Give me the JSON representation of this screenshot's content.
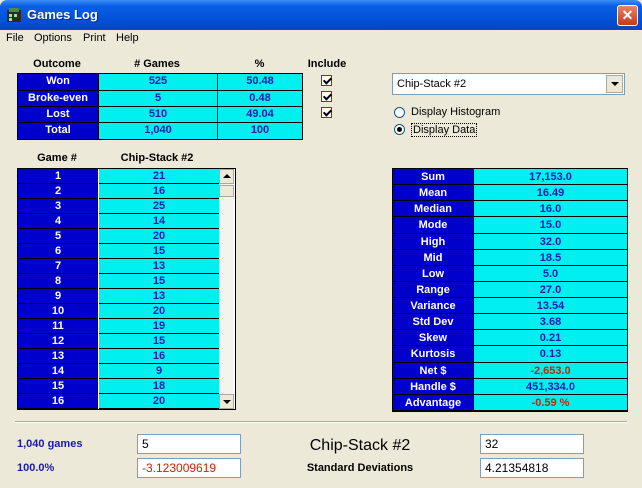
{
  "window": {
    "title": "Games Log"
  },
  "menu": [
    "File",
    "Options",
    "Print",
    "Help"
  ],
  "summary": {
    "headers": [
      "Outcome",
      "# Games",
      "%",
      "Include"
    ],
    "rows": [
      {
        "label": "Won",
        "games": "525",
        "pct": "50.48",
        "checked": true
      },
      {
        "label": "Broke-even",
        "games": "5",
        "pct": "0.48",
        "checked": true
      },
      {
        "label": "Lost",
        "games": "510",
        "pct": "49.04",
        "checked": true
      },
      {
        "label": "Total",
        "games": "1,040",
        "pct": "100"
      }
    ]
  },
  "selector": {
    "selected": "Chip-Stack #2",
    "options": [
      {
        "label": "Display Histogram",
        "selected": false
      },
      {
        "label": "Display Data",
        "selected": true
      }
    ]
  },
  "game_list": {
    "headers": [
      "Game #",
      "Chip-Stack #2"
    ],
    "rows": [
      [
        "1",
        "21"
      ],
      [
        "2",
        "16"
      ],
      [
        "3",
        "25"
      ],
      [
        "4",
        "14"
      ],
      [
        "5",
        "20"
      ],
      [
        "6",
        "15"
      ],
      [
        "7",
        "13"
      ],
      [
        "8",
        "15"
      ],
      [
        "9",
        "13"
      ],
      [
        "10",
        "20"
      ],
      [
        "11",
        "19"
      ],
      [
        "12",
        "15"
      ],
      [
        "13",
        "16"
      ],
      [
        "14",
        "9"
      ],
      [
        "15",
        "18"
      ],
      [
        "16",
        "20"
      ]
    ]
  },
  "stats": [
    {
      "label": "Sum",
      "value": "17,153.0"
    },
    {
      "label": "Mean",
      "value": "16.49"
    },
    {
      "label": "Median",
      "value": "16.0"
    },
    {
      "label": "Mode",
      "value": "15.0"
    },
    {
      "label": "High",
      "value": "32.0"
    },
    {
      "label": "Mid",
      "value": "18.5"
    },
    {
      "label": "Low",
      "value": "5.0"
    },
    {
      "label": "Range",
      "value": "27.0"
    },
    {
      "label": "Variance",
      "value": "13.54"
    },
    {
      "label": "Std Dev",
      "value": "3.68"
    },
    {
      "label": "Skew",
      "value": "0.21"
    },
    {
      "label": "Kurtosis",
      "value": "0.13"
    },
    {
      "label": "Net $",
      "value": "-2,653.0",
      "negative": true
    },
    {
      "label": "Handle $",
      "value": "451,334.0"
    },
    {
      "label": "Advantage",
      "value": "-0.59 %",
      "negative": true
    }
  ],
  "footer": {
    "games_count": "1,040 games",
    "percent": "100.0%",
    "field_left_top": "5",
    "field_left_bottom": "-3.123009619",
    "title": "Chip-Stack #2",
    "subtitle": "Standard Deviations",
    "field_right_top": "32",
    "field_right_bottom": "4.21354818"
  },
  "colors": {
    "label_bg": "#0000cc",
    "value_bg": "#00f0f0",
    "negative": "#cc2200"
  }
}
